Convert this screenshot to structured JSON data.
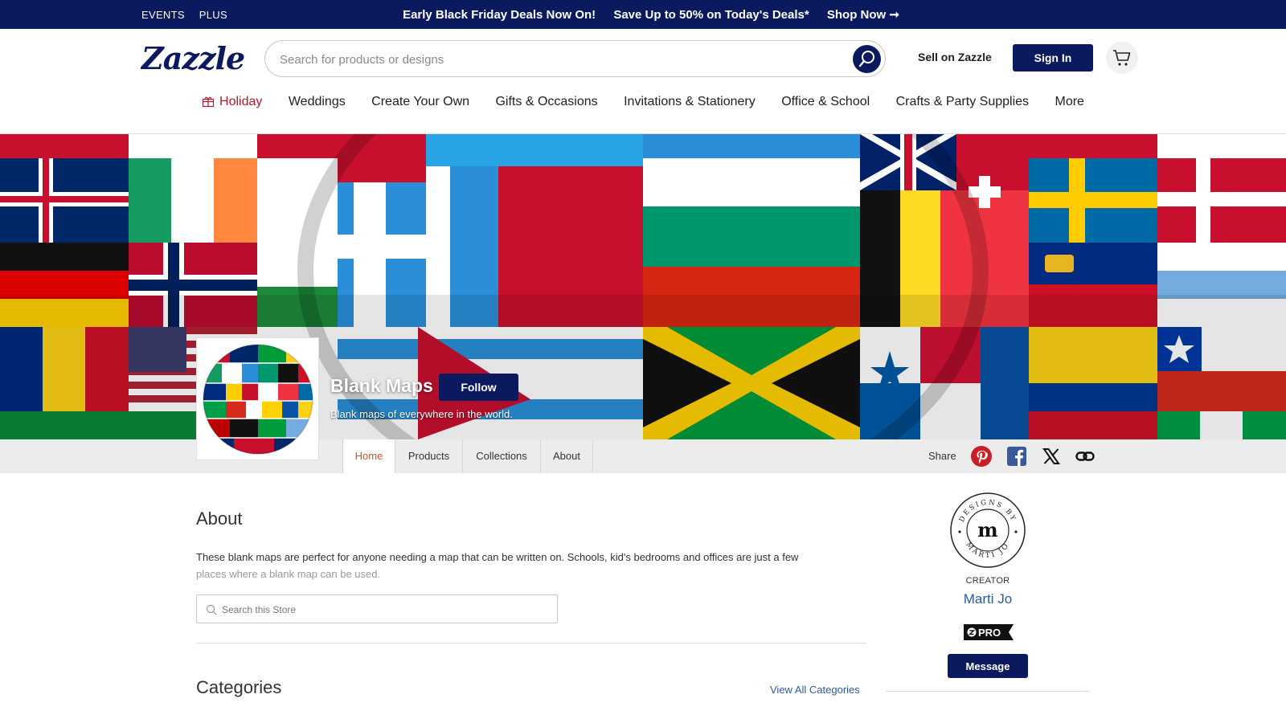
{
  "promo": {
    "links": [
      "EVENTS",
      "PLUS"
    ],
    "headline": "Early Black Friday Deals Now On!",
    "offer": "Save Up to 50% on Today's Deals*",
    "cta": "Shop Now ➞"
  },
  "header": {
    "logo": "Zazzle",
    "search_placeholder": "Search for products or designs",
    "sell_label": "Sell on Zazzle",
    "signin_label": "Sign In",
    "icons": [
      "search-icon",
      "cart-icon"
    ]
  },
  "nav": {
    "items": [
      "Holiday",
      "Weddings",
      "Create Your Own",
      "Gifts & Occasions",
      "Invitations & Stationery",
      "Office & School",
      "Crafts & Party Supplies",
      "More"
    ],
    "holiday_color": "#b5192c",
    "holiday_icon": "gift-icon"
  },
  "store": {
    "name": "Blank Maps",
    "follow_label": "Follow",
    "tagline": "Blank maps of everywhere in the world.",
    "banner": "flags-of-the-world-banner"
  },
  "tabs": {
    "items": [
      "Home",
      "Products",
      "Collections",
      "About"
    ],
    "active": "Home",
    "share_label": "Share",
    "share_icons": [
      "pinterest-icon",
      "facebook-icon",
      "x-icon",
      "link-icon"
    ]
  },
  "about": {
    "title": "About",
    "text_line1": "These blank maps are perfect for anyone needing a map that can be written on. Schools, kid's bedrooms and offices are just a few",
    "text_line2": "places where a blank map can be used.",
    "search_placeholder": "Search this Store"
  },
  "categories": {
    "title": "Categories",
    "view_all": "View All Categories"
  },
  "creator": {
    "logo_ring_text": "DESIGNS BY · MARTI JO",
    "logo_letter": "m",
    "label": "CREATOR",
    "name": "Marti Jo",
    "badge": "PRO",
    "message_label": "Message"
  },
  "colors": {
    "brand_navy": "#0b1a5f",
    "active_tab": "#c4592a",
    "link_blue": "#2a5a99"
  }
}
